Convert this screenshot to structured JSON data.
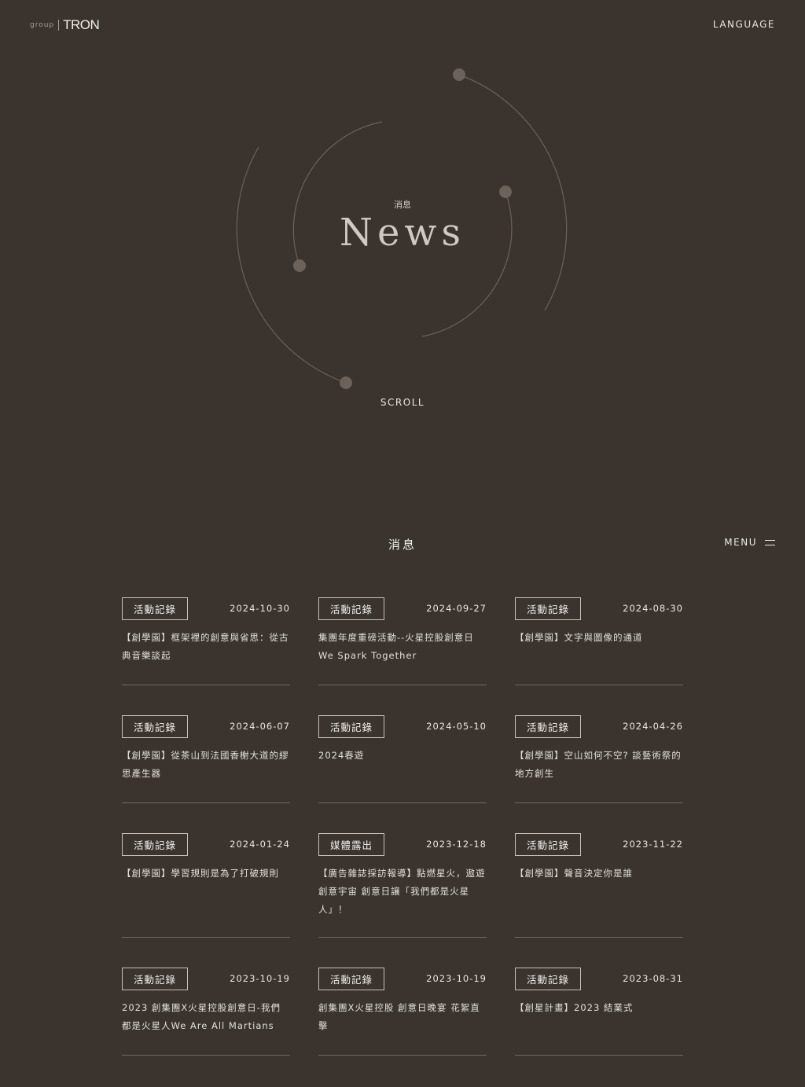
{
  "header": {
    "logo_group": "group",
    "logo_brand": "TRON",
    "language_label": "LANGUAGE",
    "menu_label": "MENU"
  },
  "hero": {
    "subtitle": "消息",
    "title": "News",
    "scroll_label": "SCROLL"
  },
  "section": {
    "title": "消息"
  },
  "news": [
    {
      "tag": "活動記錄",
      "date": "2024-10-30",
      "title": "【創學園】框架裡的創意與省思：從古典音樂談起"
    },
    {
      "tag": "活動記錄",
      "date": "2024-09-27",
      "title": "集團年度重磅活動--火星控股創意日 We Spark Together"
    },
    {
      "tag": "活動記錄",
      "date": "2024-08-30",
      "title": "【創學園】文字與圖像的通道"
    },
    {
      "tag": "活動記錄",
      "date": "2024-06-07",
      "title": "【創學園】從茶山到法國香榭大道的繆思產生器"
    },
    {
      "tag": "活動記錄",
      "date": "2024-05-10",
      "title": "2024春遊"
    },
    {
      "tag": "活動記錄",
      "date": "2024-04-26",
      "title": "【創學園】空山如何不空? 談藝術祭的地方創生"
    },
    {
      "tag": "活動記錄",
      "date": "2024-01-24",
      "title": "【創學園】學習規則是為了打破規則"
    },
    {
      "tag": "媒體露出",
      "date": "2023-12-18",
      "title": "【廣告雜誌採訪報導】點燃星火，遨遊創意宇宙 創意日讓「我們都是火星人」！"
    },
    {
      "tag": "活動記錄",
      "date": "2023-11-22",
      "title": "【創學園】聲音決定你是誰"
    },
    {
      "tag": "活動記錄",
      "date": "2023-10-19",
      "title": "2023 創集團X火星控股創意日-我們都是火星人We Are All Martians"
    },
    {
      "tag": "活動記錄",
      "date": "2023-10-19",
      "title": "創集團X火星控股 創意日晚宴 花絮直擊"
    },
    {
      "tag": "活動記錄",
      "date": "2023-08-31",
      "title": "【創星計畫】2023 結業式"
    }
  ]
}
